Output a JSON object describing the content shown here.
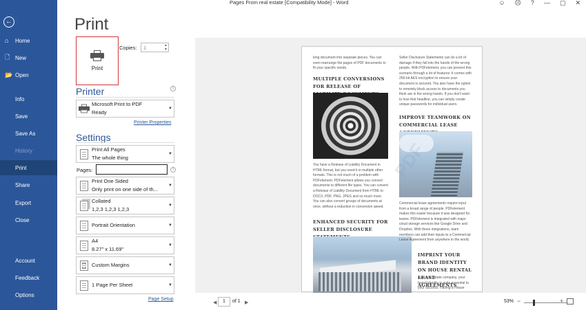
{
  "window": {
    "title": "Pages From real estate [Compatibility Mode]  -  Word",
    "controls": [
      "☺",
      "☹",
      "?",
      "—",
      "▢",
      "✕"
    ]
  },
  "sidebar": {
    "back_symbol": "←",
    "items": [
      {
        "label": "Home",
        "icon": "⌂"
      },
      {
        "label": "New",
        "icon": "🗋"
      },
      {
        "label": "Open",
        "icon": "📂"
      },
      {
        "label": "Info",
        "icon": ""
      },
      {
        "label": "Save",
        "icon": ""
      },
      {
        "label": "Save As",
        "icon": ""
      },
      {
        "label": "History",
        "icon": ""
      },
      {
        "label": "Print",
        "icon": ""
      },
      {
        "label": "Share",
        "icon": ""
      },
      {
        "label": "Export",
        "icon": ""
      },
      {
        "label": "Close",
        "icon": ""
      },
      {
        "label": "Account",
        "icon": ""
      },
      {
        "label": "Feedback",
        "icon": ""
      },
      {
        "label": "Options",
        "icon": ""
      }
    ],
    "active": "Print",
    "disabled": "History"
  },
  "print": {
    "heading": "Print",
    "button_label": "Print",
    "copies_label": "Copies:",
    "copies_value": "1"
  },
  "printer": {
    "heading": "Printer",
    "name": "Microsoft Print to PDF",
    "status": "Ready",
    "properties_link": "Printer Properties"
  },
  "settings": {
    "heading": "Settings",
    "pages_label": "Pages:",
    "pages_value": "",
    "options": [
      {
        "line1": "Print All Pages",
        "line2": "The whole thing"
      },
      {
        "line1": "Print One Sided",
        "line2": "Only print on one side of th..."
      },
      {
        "line1": "Collated",
        "line2": "1,2,3    1,2,3    1,2,3"
      },
      {
        "line1": "Portrait Orientation",
        "line2": ""
      },
      {
        "line1": "A4",
        "line2": "8.27\" x 11.69\""
      },
      {
        "line1": "Custom Margins",
        "line2": ""
      },
      {
        "line1": "1 Page Per Sheet",
        "line2": ""
      }
    ],
    "page_setup_link": "Page Setup"
  },
  "preview": {
    "left_col_top": "long document into separate pieces. You can even rearrange the pages of PDF documents to fit your specific needs.",
    "heading_multiple": "MULTIPLE CONVERSIONS FOR RELEASE OF LIABILITY DOCUMENTS",
    "left_col_mid": "You have a Release of Liability Document in HTML format, but you need it in multiple other formats. This is not much of a problem with PDFelement. PDFelement allows you convert documents to different file types. You can convert a Release of Liability Document from HTML to DOCX, PDF, PNG, JPEG and so much more. You can also convert groups of documents at once, without a reduction in conversion speed.",
    "heading_enhanced": "ENHANCED SECURITY FOR SELLER DISCLOSURE STATEMENTS",
    "right_col_top": "Seller Disclosure Statements can do a lot of damage if they fall into the hands of the wrong people. With PDFelement, you can prevent this scenario through a lot of features. It comes with 256-bit AES encryption to ensure your document is secured. You also have the option to remotely block access to documents you think are in the wrong hands. If you don't want to lose that headline, you can simply create unique passwords for individual users.",
    "heading_improve": "IMPROVE TEAMWORK ON COMMERCIAL LEASE AGREEMENTS",
    "right_col_mid": "Commercial lease agreements require input from a broad range of people. PDFelement makes this easier because it was designed for teams. PDFelement is integrated with major cloud storage services like Google Drive and Dropbox. With these integrations, team members can add their inputs to a Commercial Lease Agreement from anywhere in the world.",
    "heading_imprint": "IMPRINT YOUR BRAND IDENTITY ON HOUSE RENTAL LEASE AGREEMENTS",
    "right_col_bottom": "As a real estate company, your brand identity is quite essential to your success. Having a House",
    "watermark": "PDF"
  },
  "footer": {
    "prev": "◀",
    "page_num": "1",
    "of": "of 1",
    "next": "▶",
    "zoom": "53%",
    "zoom_minus": "−",
    "zoom_plus": "+"
  }
}
